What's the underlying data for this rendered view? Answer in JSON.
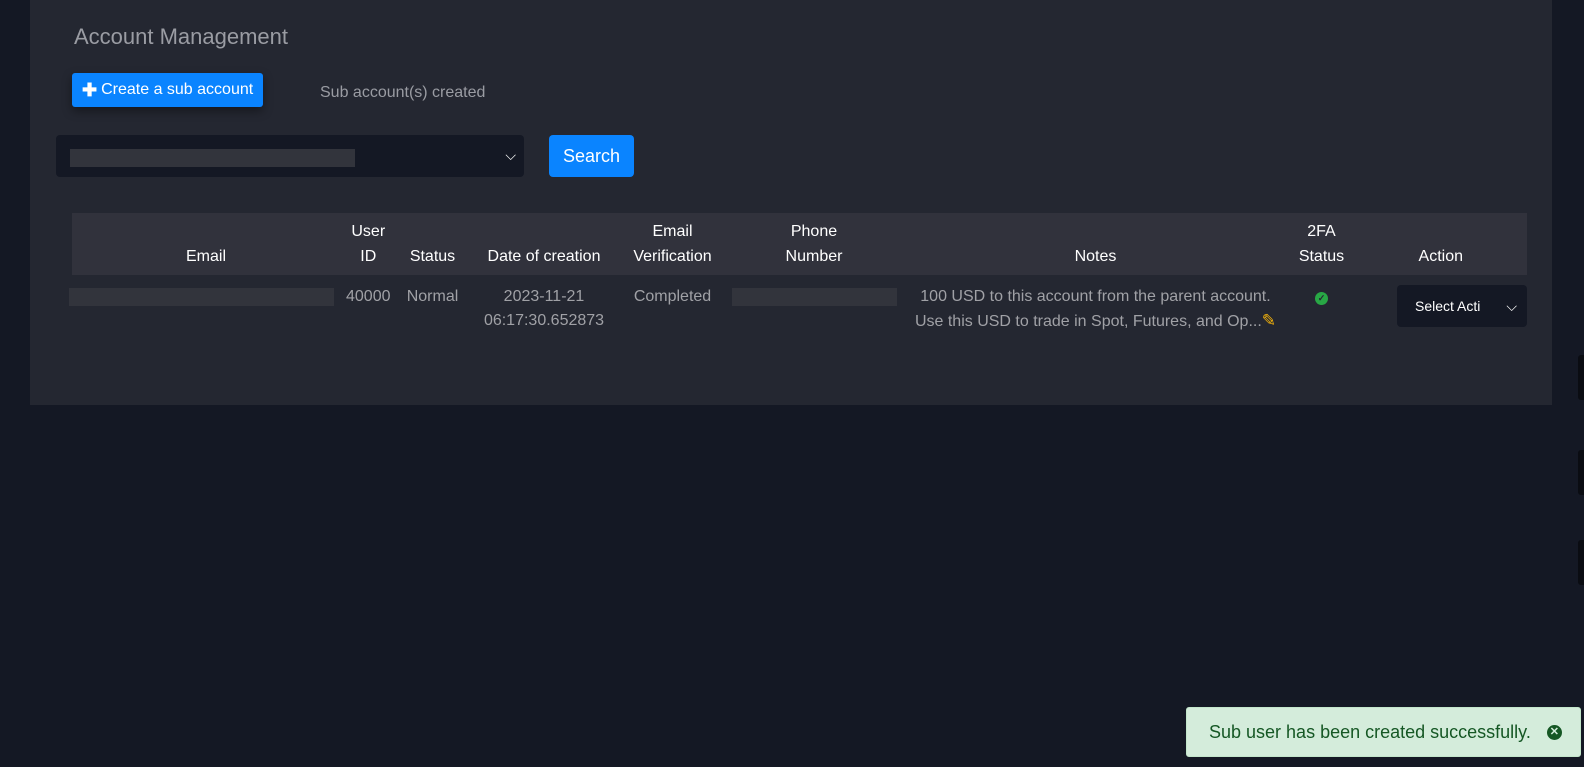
{
  "page": {
    "title": "Account Management"
  },
  "toolbar": {
    "create_label": "Create a sub account",
    "create_icon": "plus-icon",
    "sub_count_label": "Sub account(s) created"
  },
  "search": {
    "select_value": "",
    "search_label": "Search"
  },
  "table": {
    "headers": [
      {
        "line1": "",
        "line2": "Email"
      },
      {
        "line1": "User",
        "line2": "ID"
      },
      {
        "line1": "",
        "line2": "Status"
      },
      {
        "line1": "",
        "line2": "Date of creation"
      },
      {
        "line1": "Email",
        "line2": "Verification"
      },
      {
        "line1": "Phone",
        "line2": "Number"
      },
      {
        "line1": "",
        "line2": "Notes"
      },
      {
        "line1": "2FA",
        "line2": "Status"
      },
      {
        "line1": "",
        "line2": "Action"
      }
    ],
    "rows": [
      {
        "email": "",
        "user_id": "40000",
        "status": "Normal",
        "date_line1": "2023-11-21",
        "date_line2": "06:17:30.652873",
        "email_verification": "Completed",
        "phone": "",
        "notes": "100 USD to this account from the parent account. Use this USD to trade in Spot, Futures, and Op...",
        "twofa_status": "enabled",
        "action_label": "Select Acti"
      }
    ]
  },
  "toast": {
    "message": "Sub user has been created successfully.",
    "type": "success"
  },
  "colors": {
    "primary": "#0a84ff",
    "success": "#28a745",
    "warning": "#f5b30a",
    "toast_bg": "#d4ecdb"
  }
}
